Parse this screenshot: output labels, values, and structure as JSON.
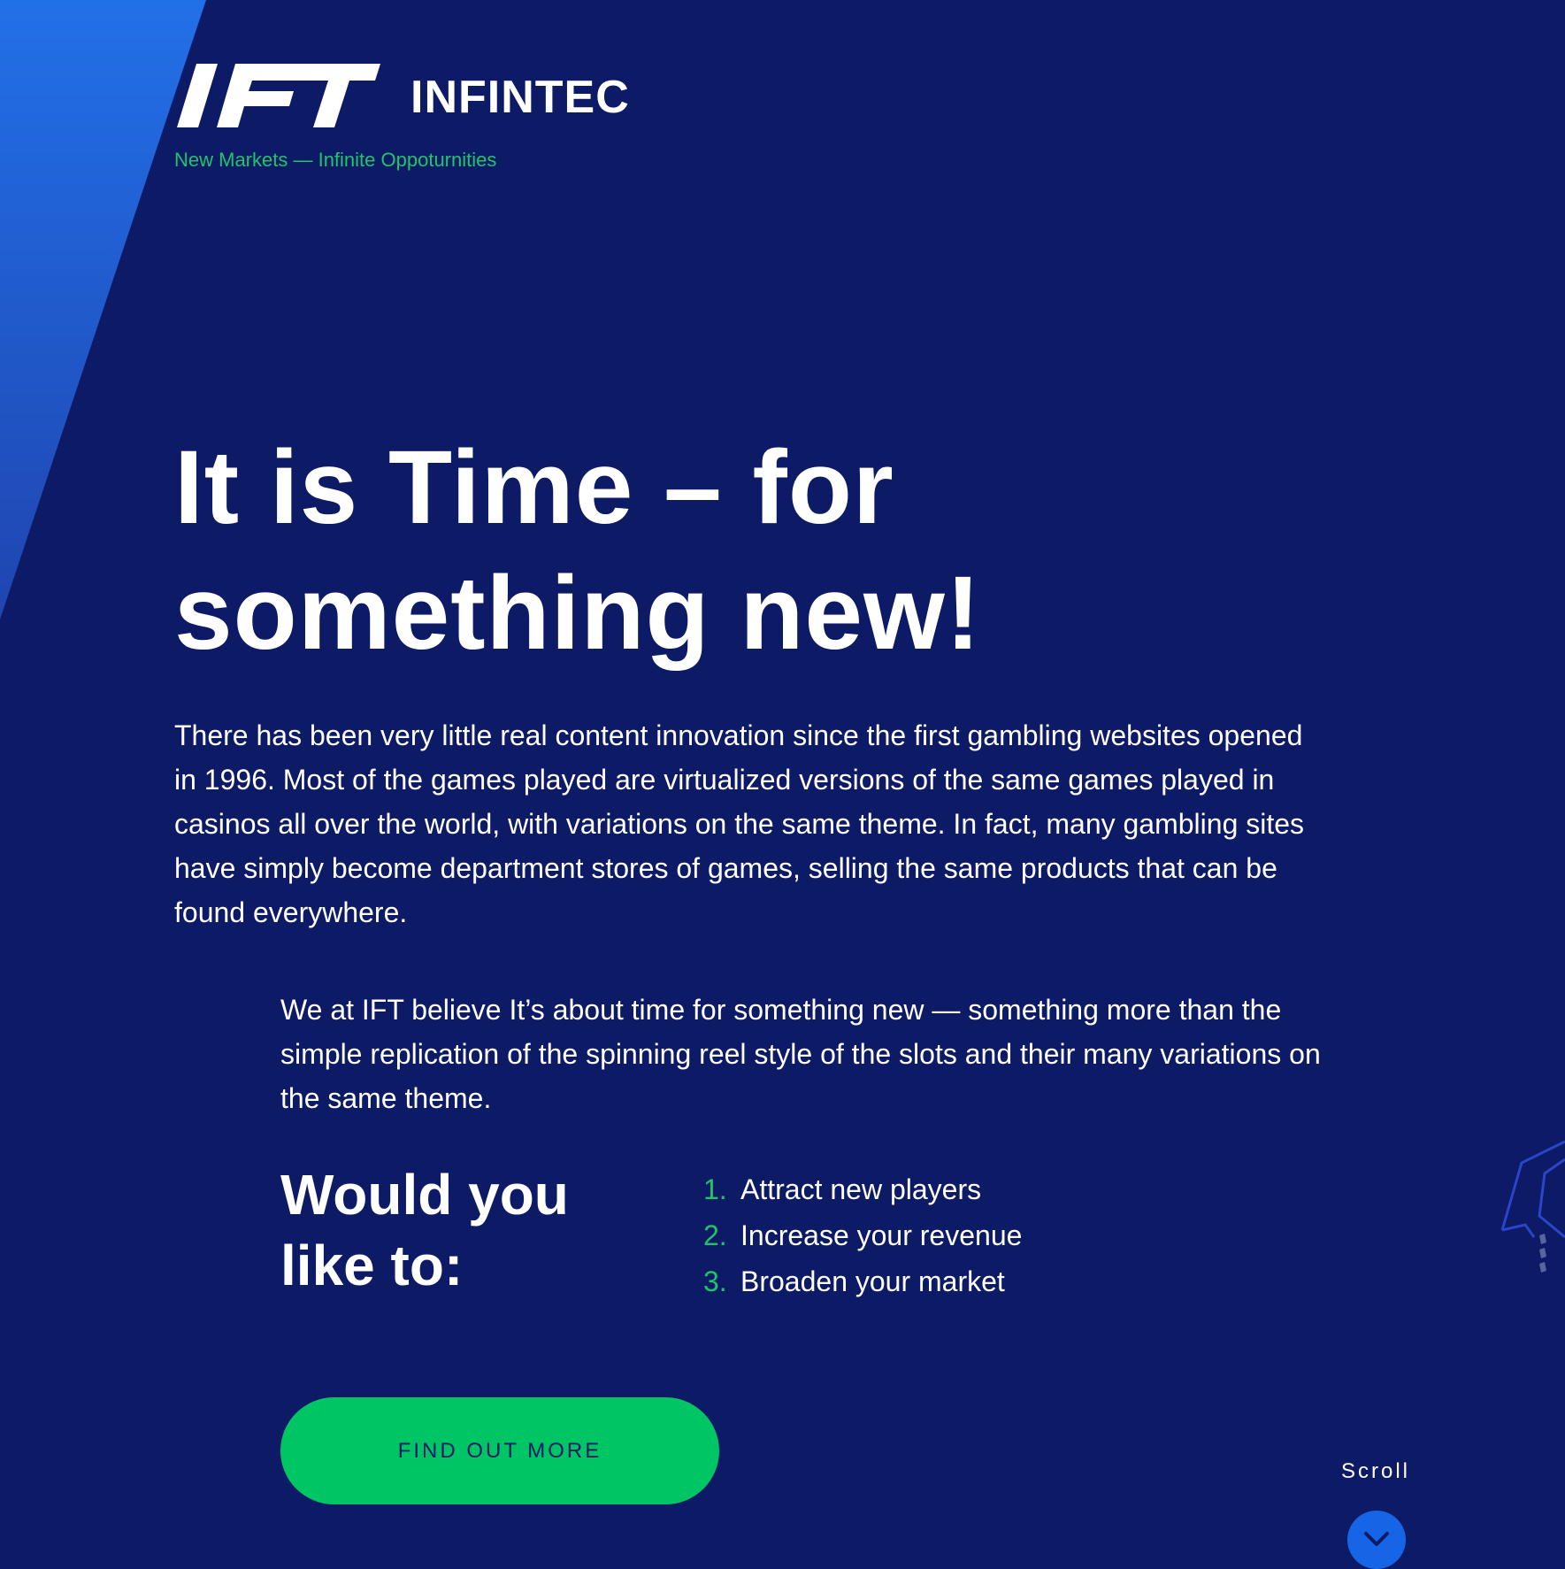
{
  "brand": {
    "logo_text": "IFT",
    "name": "INFINTEC",
    "tagline": "New Markets — Infinite Oppoturnities"
  },
  "hero": {
    "headline": "It is Time – for something new!",
    "intro": "There has been very little real content innovation since the first gambling websites opened in 1996. Most of the games played are virtualized versions of the same games played in casinos all over the world, with variations on the same theme. In fact, many gambling sites have simply become department stores of games, selling the same products that can be found everywhere.",
    "belief": "We at IFT believe It’s about time for something new — something more than the simple replication of the spinning reel style of the slots and their many variations on the same theme."
  },
  "offer": {
    "question": "Would you like to:",
    "items": [
      {
        "number": "1.",
        "text": "Attract new players"
      },
      {
        "number": "2.",
        "text": "Increase your revenue"
      },
      {
        "number": "3.",
        "text": "Broaden your market"
      }
    ]
  },
  "cta": {
    "label": "FIND OUT MORE"
  },
  "scroll": {
    "label": "Scroll",
    "icon": "chevron-down-icon"
  },
  "colors": {
    "background": "#0d1a66",
    "accent_green": "#00c565",
    "stripe_blue": "#2270e8",
    "scroll_blue": "#1565e6",
    "text": "#ffffff"
  }
}
